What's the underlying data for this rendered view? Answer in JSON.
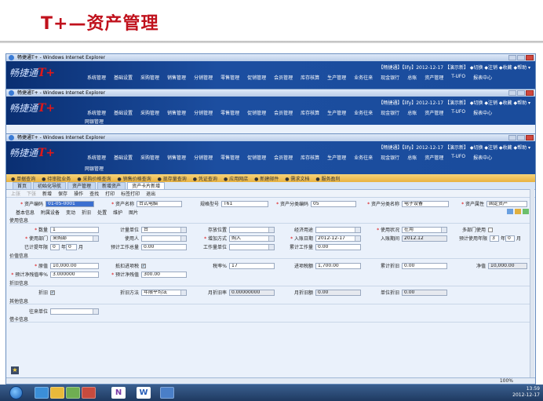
{
  "slide_title": "T+—资产管理",
  "window_title": "畅捷通T+ - Windows Internet Explorer",
  "logo_text": "畅捷通",
  "logo_mark": "T+",
  "userbar": "【畅捷通】【lify】2012-12-17 【演示新】  ◆切换  ◆注销  ◆收藏  ◆帮助  ▾",
  "main_nav": [
    "系统管理",
    "基础设置",
    "采购管理",
    "销售管理",
    "分销管理",
    "零售管理",
    "促销管理",
    "会员管理",
    "库存核算",
    "生产管理",
    "业务往来",
    "现金银行",
    "总账",
    "资产管理",
    "T-UFO",
    "报表中心"
  ],
  "sub_nav": "网银管理",
  "shortcuts": [
    "单据查询",
    "待审批业务",
    "采购价格查询",
    "销售价格查询",
    "现存量查询",
    "凭证查询",
    "应用网店",
    "新建邮件",
    "需求文档",
    "服务盈利"
  ],
  "tabs": [
    "首页",
    "初始化导航",
    "资产管理",
    "新增资产",
    "资产卡片新增"
  ],
  "toolbar": [
    "上张",
    "下张",
    "新增",
    "保存",
    "操作",
    "查找",
    "打印",
    "标签打印",
    "退出"
  ],
  "form": {
    "asset_code_label": "资产编码",
    "asset_code": "01-05-0001",
    "asset_name_label": "资产名称",
    "asset_name": "台式电脑",
    "spec_label": "规格型号",
    "spec": "T61",
    "category_code_label": "资产分类编码",
    "category_code": "05",
    "category_name_label": "资产分类名称",
    "category_name": "电子设备",
    "property_label": "资产属性",
    "property": "固定资产"
  },
  "sub_tabs": [
    "基本信息",
    "附属设备",
    "变动",
    "折旧",
    "处置",
    "维护",
    "图片"
  ],
  "sections": {
    "usage": "使用信息",
    "value": "价值信息",
    "depr": "折旧信息",
    "other": "其他信息",
    "borrow": "借卡信息"
  },
  "usage": {
    "qty_label": "数量",
    "qty": "1",
    "unit_label": "计量单位",
    "unit": "台",
    "location_label": "存放位置",
    "location": "",
    "purpose_label": "经济用途",
    "purpose": "",
    "status_label": "使用状况",
    "status": "在用",
    "multi_dept_label": "多部门使用",
    "dept_label": "使用部门",
    "dept": "采购部",
    "user_label": "使用人",
    "user": "",
    "add_method_label": "增加方式",
    "add_method": "购入",
    "entry_date_label": "入账日期",
    "entry_date": "2012-12-17",
    "entry_period_label": "入账期间",
    "entry_period": "2012.12",
    "life_label": "预计使用年限",
    "life_years": "3",
    "life_unit_year": "年",
    "life_months": "0",
    "life_unit_month": "月",
    "used_label": "已计提年限",
    "used_years": "0",
    "used_unit_year": "年",
    "used_months": "0",
    "used_unit_month": "月",
    "total_work_label": "预计工作总量",
    "total_work": "0.00",
    "work_unit_label": "工作量单位",
    "work_unit": "",
    "acc_work_label": "累计工作量",
    "acc_work": "0.00"
  },
  "value": {
    "orig_label": "原值",
    "orig": "10,000.00",
    "tax_label": "抵扣进项税",
    "tax_checked": "✓",
    "tax_rate_label": "税率%",
    "tax_rate": "17",
    "tax_amt_label": "进项税额",
    "tax_amt": "1,700.00",
    "acc_dep_label": "累计折旧",
    "acc_dep": "0.00",
    "net_label": "净值",
    "net": "10,000.00",
    "residual_rate_label": "预计净残值率%",
    "residual_rate": "3.000000",
    "residual_label": "预计净残值",
    "residual": "300.00"
  },
  "depr": {
    "dep_label": "折旧",
    "dep_checked": "✓",
    "method_label": "折旧方法",
    "method": "年限平均法",
    "month_rate_label": "月折旧率",
    "month_rate": "0.00000000",
    "month_amt_label": "月折旧额",
    "month_amt": "0.00",
    "unit_dep_label": "单位折旧",
    "unit_dep": "0.00"
  },
  "other": {
    "vendor_label": "往来单位",
    "vendor": ""
  },
  "status_zoom": "100%",
  "clock_time": "13:59",
  "clock_date": "2012-12-17",
  "colors": {
    "title_red": "#c0111c",
    "nav_blue": "#0a2f72",
    "shortcut_orange": "#e9b23f"
  }
}
